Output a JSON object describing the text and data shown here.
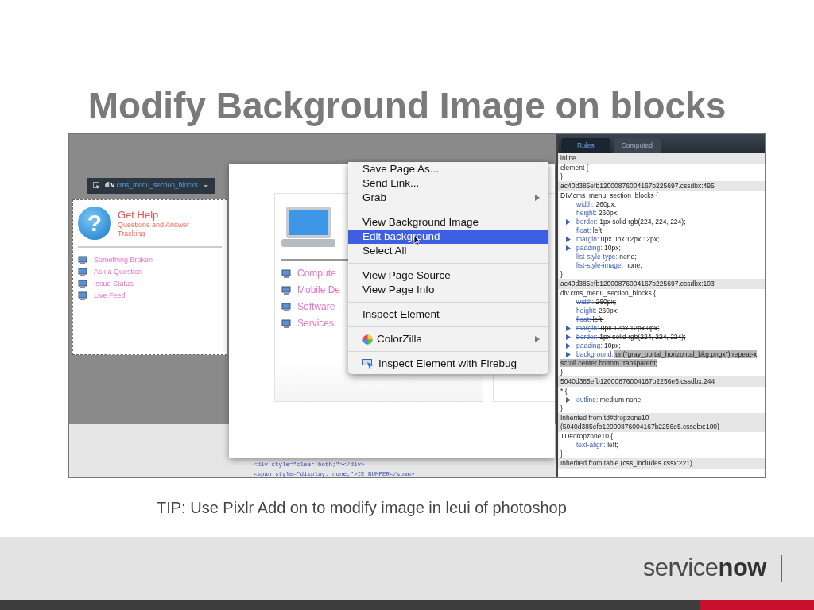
{
  "slide_title": "Modify Background Image on blocks",
  "screenshot": {
    "inspector_tooltip": {
      "label": "**div**.cms_menu_section_blocks"
    },
    "help_block": {
      "icon_glyph": "?",
      "title": "Get Help",
      "subtitle": "Questions and Answer Tracking",
      "links": [
        {
          "label": "Something Broken"
        },
        {
          "label": "Ask a Question"
        },
        {
          "label": "Issue Status"
        },
        {
          "label": "Live Feed"
        }
      ]
    },
    "popup": {
      "links": [
        {
          "label": "Compute"
        },
        {
          "label": "Mobile De"
        },
        {
          "label": "Software"
        },
        {
          "label": "Services"
        }
      ]
    },
    "code_lines": [
      "<div style=\"clear:both;\"></div>",
      "<span style=\"display: none;\">IE BUMPER</span>"
    ],
    "context_menu": {
      "groups": [
        {
          "items": [
            {
              "label": "Save Page As...",
              "kind": "text",
              "submenu": false,
              "selected": false
            },
            {
              "label": "Send Link...",
              "kind": "text",
              "submenu": false,
              "selected": false
            },
            {
              "label": "Grab",
              "kind": "text",
              "submenu": true,
              "selected": false
            }
          ]
        },
        {
          "items": [
            {
              "label": "View Background Image",
              "kind": "text",
              "submenu": false,
              "selected": false
            },
            {
              "label": "Edit background",
              "kind": "text",
              "submenu": false,
              "selected": true
            },
            {
              "label": "Select All",
              "kind": "text",
              "submenu": false,
              "selected": false
            }
          ]
        },
        {
          "items": [
            {
              "label": "View Page Source",
              "kind": "text",
              "submenu": false,
              "selected": false
            },
            {
              "label": "View Page Info",
              "kind": "text",
              "submenu": false,
              "selected": false
            }
          ]
        },
        {
          "items": [
            {
              "label": "Inspect Element",
              "kind": "text",
              "submenu": false,
              "selected": false
            }
          ]
        },
        {
          "items": [
            {
              "label": "ColorZilla",
              "kind": "wheel",
              "submenu": true,
              "selected": false
            }
          ]
        },
        {
          "items": [
            {
              "label": "Inspect Element with Firebug",
              "kind": "pointer",
              "submenu": false,
              "selected": false
            }
          ]
        }
      ]
    },
    "css_panel": {
      "tabs": [
        {
          "label": "Rules",
          "selected": true
        },
        {
          "label": "Computed",
          "selected": false
        }
      ],
      "lines": [
        {
          "kind": "section",
          "text": "inline"
        },
        {
          "kind": "line",
          "text": "element {"
        },
        {
          "kind": "line",
          "text": "}"
        },
        {
          "kind": "section",
          "text": "ac40d385efb12000876004167b225697.cssdbx:495"
        },
        {
          "kind": "line",
          "text": "DIV.cms_menu_section_blocks {"
        },
        {
          "kind": "prop",
          "name": "width:",
          "value": "260px;",
          "expandable": false,
          "overridden": false,
          "highlighted": false
        },
        {
          "kind": "prop",
          "name": "height:",
          "value": "260px;",
          "expandable": false,
          "overridden": false,
          "highlighted": false
        },
        {
          "kind": "prop",
          "name": "border:",
          "value": "1px solid rgb(224, 224, 224);",
          "expandable": true,
          "overridden": false,
          "highlighted": false
        },
        {
          "kind": "prop",
          "name": "float:",
          "value": "left;",
          "expandable": false,
          "overridden": false,
          "highlighted": false
        },
        {
          "kind": "prop",
          "name": "margin:",
          "value": "0px 0px 12px 12px;",
          "expandable": true,
          "overridden": false,
          "highlighted": false
        },
        {
          "kind": "prop",
          "name": "padding:",
          "value": "10px;",
          "expandable": true,
          "overridden": false,
          "highlighted": false
        },
        {
          "kind": "prop",
          "name": "list-style-type:",
          "value": "none;",
          "expandable": false,
          "overridden": false,
          "highlighted": false
        },
        {
          "kind": "prop",
          "name": "list-style-image:",
          "value": "none;",
          "expandable": false,
          "overridden": false,
          "highlighted": false
        },
        {
          "kind": "line",
          "text": "}"
        },
        {
          "kind": "section",
          "text": "ac40d385efb12000876004167b225697.cssdbx:103"
        },
        {
          "kind": "line",
          "text": "div.cms_menu_section_blocks {"
        },
        {
          "kind": "prop",
          "name": "width:",
          "value": "260px;",
          "expandable": false,
          "overridden": true,
          "highlighted": false
        },
        {
          "kind": "prop",
          "name": "height:",
          "value": "260px;",
          "expandable": false,
          "overridden": true,
          "highlighted": false
        },
        {
          "kind": "prop",
          "name": "float:",
          "value": "left;",
          "expandable": false,
          "overridden": true,
          "highlighted": false
        },
        {
          "kind": "prop",
          "name": "margin:",
          "value": "0px 12px 12px 0px;",
          "expandable": true,
          "overridden": true,
          "highlighted": false
        },
        {
          "kind": "prop",
          "name": "border:",
          "value": "1px solid rgb(224, 224, 224);",
          "expandable": true,
          "overridden": true,
          "highlighted": false
        },
        {
          "kind": "prop",
          "name": "padding:",
          "value": "10px;",
          "expandable": true,
          "overridden": true,
          "highlighted": false
        },
        {
          "kind": "prop",
          "name": "background:",
          "value": "url(\"gray_portal_horizontal_bkg.pngx\") repeat-x scroll center bottom transparent;",
          "expandable": true,
          "overridden": false,
          "highlighted": true
        },
        {
          "kind": "line",
          "text": "}"
        },
        {
          "kind": "section",
          "text": "5040d385efb12000876004167b2256e5.cssdbx:244"
        },
        {
          "kind": "line",
          "text": "* {"
        },
        {
          "kind": "prop",
          "name": "outline:",
          "value": "medium none;",
          "expandable": true,
          "overridden": false,
          "highlighted": false
        },
        {
          "kind": "line",
          "text": "}"
        },
        {
          "kind": "section",
          "text": "Inherited from td#dropzone10 (5040d385efb12000876004167b2256e5.cssdbx:100)"
        },
        {
          "kind": "line",
          "text": "TD#dropzone10 {"
        },
        {
          "kind": "prop",
          "name": "text-align:",
          "value": "left;",
          "expandable": false,
          "overridden": false,
          "highlighted": false
        },
        {
          "kind": "line",
          "text": "}"
        },
        {
          "kind": "section",
          "text": "Inherited from table (css_includes.cssx:221)"
        }
      ]
    }
  },
  "tip": "TIP: Use Pixlr Add on to modify image in leui of photoshop",
  "logo": "service**now**"
}
